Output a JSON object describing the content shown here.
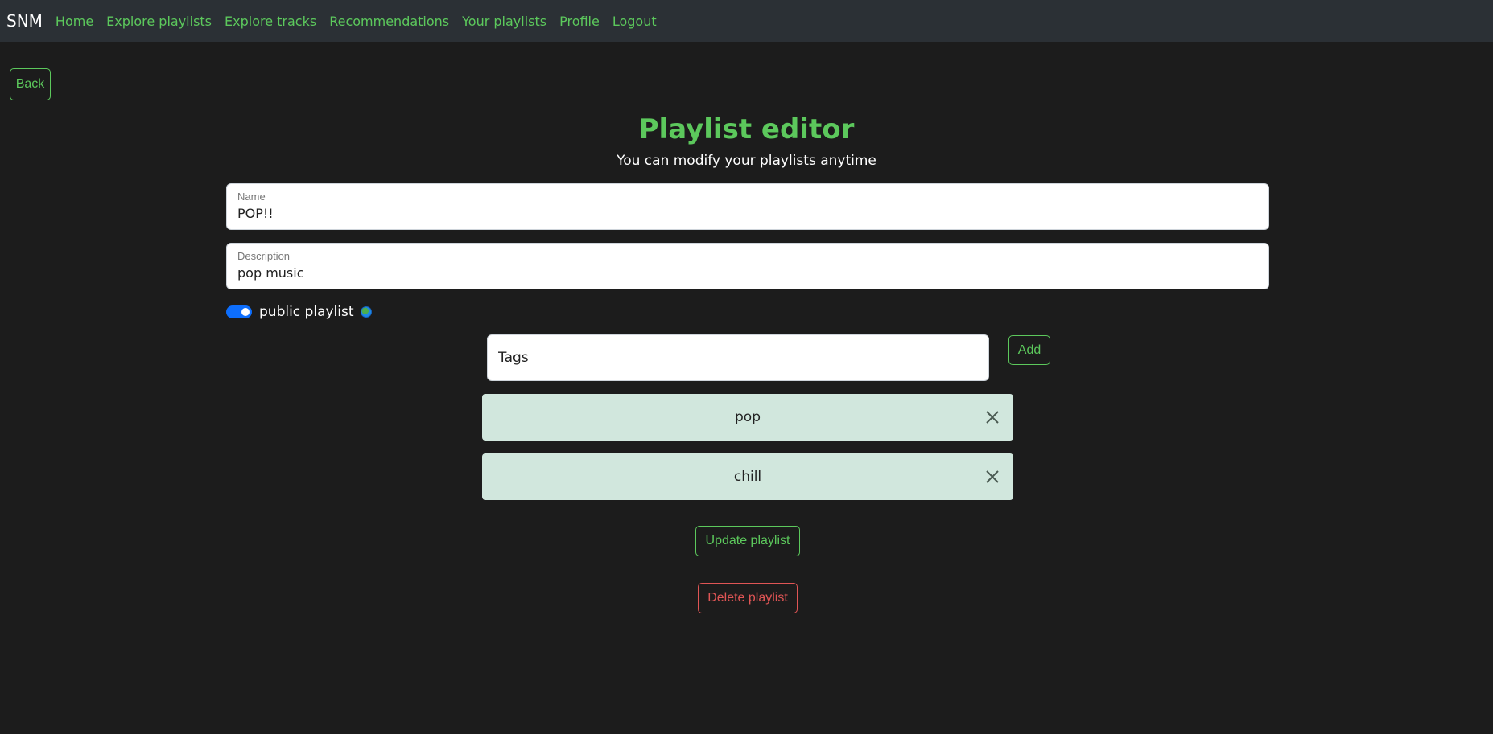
{
  "nav": {
    "brand": "SNM",
    "links": [
      "Home",
      "Explore playlists",
      "Explore tracks",
      "Recommendations",
      "Your playlists",
      "Profile",
      "Logout"
    ]
  },
  "back_label": "Back",
  "page": {
    "title": "Playlist editor",
    "subtitle": "You can modify your playlists anytime"
  },
  "form": {
    "name_label": "Name",
    "name_value": "POP!!",
    "description_label": "Description",
    "description_value": "pop music",
    "public_label": "public playlist",
    "public_on": true,
    "public_icon": "globe-icon"
  },
  "tags": {
    "placeholder": "Tags",
    "add_label": "Add",
    "items": [
      "pop",
      "chill"
    ],
    "close_icon": "close-icon"
  },
  "actions": {
    "update_label": "Update playlist",
    "delete_label": "Delete playlist"
  },
  "colors": {
    "accent": "#5cc85c",
    "danger": "#e05555",
    "toggle": "#0d6efd",
    "tag_bg": "#d1e7dd"
  }
}
